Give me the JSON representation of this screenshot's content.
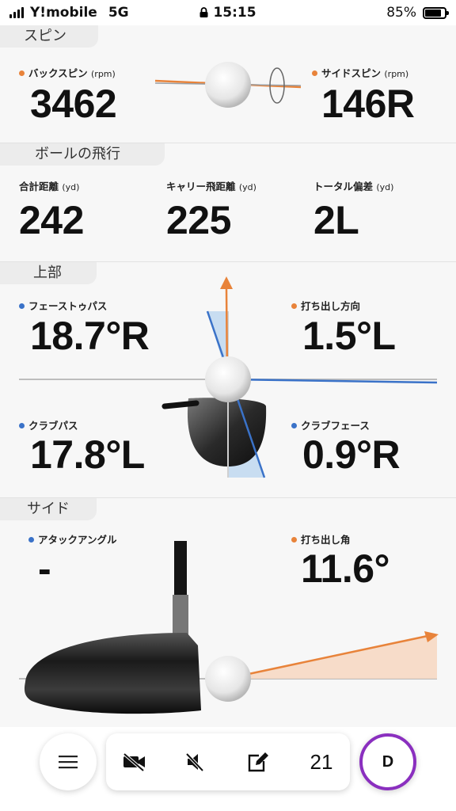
{
  "status_bar": {
    "carrier": "Y!mobile",
    "network": "5G",
    "time": "15:15",
    "battery_percent": "85%",
    "battery_level": 0.85
  },
  "spin": {
    "tab": "スピン",
    "backspin_label": "バックスピン",
    "backspin_unit": "(rpm)",
    "backspin_value": "3462",
    "sidespin_label": "サイドスピン",
    "sidespin_unit": "(rpm)",
    "sidespin_value": "146R"
  },
  "flight": {
    "tab": "ボールの飛行",
    "total_label": "合計距離",
    "total_unit": "(yd)",
    "total_value": "242",
    "carry_label": "キャリー飛距離",
    "carry_unit": "(yd)",
    "carry_value": "225",
    "deviation_label": "トータル偏差",
    "deviation_unit": "(yd)",
    "deviation_value": "2L"
  },
  "top": {
    "tab": "上部",
    "face_to_path_label": "フェーストゥパス",
    "face_to_path_value": "18.7°R",
    "launch_direction_label": "打ち出し方向",
    "launch_direction_value": "1.5°L",
    "club_path_label": "クラブパス",
    "club_path_value": "17.8°L",
    "club_face_label": "クラブフェース",
    "club_face_value": "0.9°R"
  },
  "side": {
    "tab": "サイド",
    "attack_angle_label": "アタックアングル",
    "attack_angle_value": "-",
    "launch_angle_label": "打ち出し角",
    "launch_angle_value": "11.6°"
  },
  "toolbar": {
    "shot_count": "21",
    "avatar_initial": "D",
    "menu_icon": "hamburger-icon",
    "video_icon": "video-off-icon",
    "sound_icon": "mute-icon",
    "edit_icon": "edit-icon"
  },
  "colors": {
    "orange": "#e8833a",
    "blue": "#3a72c8",
    "avatar_ring": "#8a2fbf"
  }
}
